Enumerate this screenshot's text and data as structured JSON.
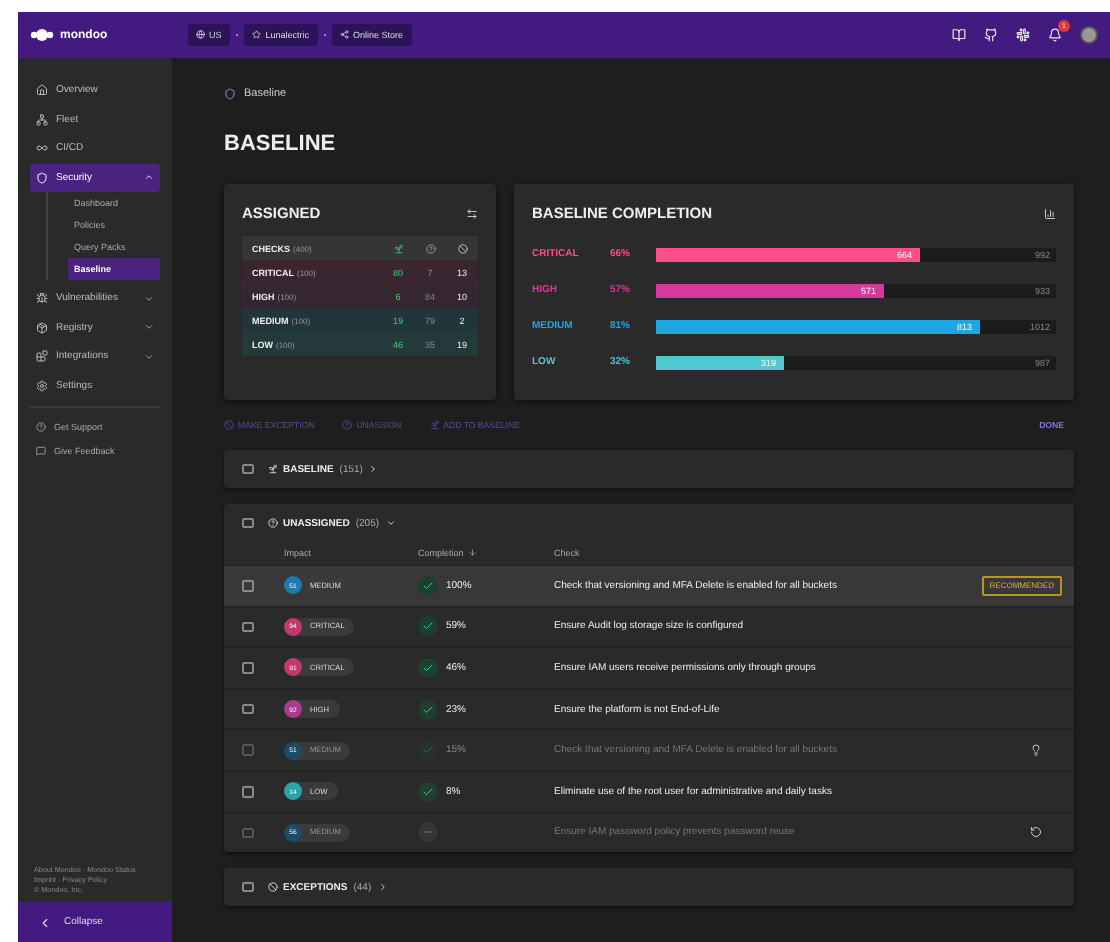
{
  "topbar": {
    "logo": "mondoo",
    "scopes": [
      {
        "label": "US"
      },
      {
        "label": "Lunalectric"
      },
      {
        "label": "Online Store"
      }
    ],
    "notifications": "1"
  },
  "sidebar": {
    "items": [
      {
        "label": "Overview",
        "kind": "link",
        "selected": false
      },
      {
        "label": "Fleet",
        "kind": "link",
        "selected": false
      },
      {
        "label": "CI/CD",
        "kind": "link",
        "selected": false
      },
      {
        "label": "Security",
        "kind": "group",
        "selected": true,
        "expanded": true,
        "children": [
          {
            "label": "Dashboard",
            "selected": false
          },
          {
            "label": "Policies",
            "selected": false
          },
          {
            "label": "Query Packs",
            "selected": false
          },
          {
            "label": "Baseline",
            "selected": true
          }
        ]
      },
      {
        "label": "Vulnerabilities",
        "kind": "group",
        "selected": false,
        "expanded": false
      },
      {
        "label": "Registry",
        "kind": "group",
        "selected": false,
        "expanded": false
      },
      {
        "label": "Integrations",
        "kind": "group",
        "selected": false,
        "expanded": false
      },
      {
        "label": "Settings",
        "kind": "link",
        "selected": false
      }
    ],
    "support": [
      "Get Support",
      "Give Feedback"
    ],
    "footer": [
      "About Mondoo · Mondoo Status ·",
      "Imprint · Privacy Policy",
      "© Mondoo, Inc."
    ],
    "collapse": "Collapse"
  },
  "breadcrumb": "Baseline",
  "title": "BASELINE",
  "assigned": {
    "title": "ASSIGNED",
    "header": {
      "label": "CHECKS",
      "count": "(400)"
    },
    "rows": [
      {
        "label": "CRITICAL",
        "count": "(100)",
        "color": "#3a2630",
        "values": [
          "80",
          "7",
          "13"
        ]
      },
      {
        "label": "HIGH",
        "count": "(100)",
        "color": "#36262f",
        "values": [
          "6",
          "84",
          "10"
        ]
      },
      {
        "label": "MEDIUM",
        "count": "(100)",
        "color": "#22353a",
        "values": [
          "19",
          "79",
          "2"
        ]
      },
      {
        "label": "LOW",
        "count": "(100)",
        "color": "#24393a",
        "values": [
          "46",
          "35",
          "19"
        ]
      }
    ]
  },
  "completion": {
    "title": "BASELINE COMPLETION",
    "rows": [
      {
        "label": "CRITICAL",
        "percent": "66%",
        "level": 0.66,
        "value": "664",
        "total": "992",
        "color": "#ff4f86"
      },
      {
        "label": "HIGH",
        "percent": "57%",
        "level": 0.57,
        "value": "571",
        "total": "933",
        "color": "#d6399a"
      },
      {
        "label": "MEDIUM",
        "percent": "81%",
        "level": 0.81,
        "value": "813",
        "total": "1012",
        "color": "#1ea7e0"
      },
      {
        "label": "LOW",
        "percent": "32%",
        "level": 0.32,
        "value": "319",
        "total": "987",
        "color": "#4fc8d0"
      }
    ]
  },
  "actions": [
    {
      "label": "MAKE EXCEPTION",
      "kind": "exception"
    },
    {
      "label": "UNASSIGN",
      "kind": "unassign"
    },
    {
      "label": "ADD TO BASELINE",
      "kind": "baseline"
    }
  ],
  "done": "DONE",
  "groups": [
    {
      "label": "BASELINE",
      "count": "(151)",
      "kind": "baseline",
      "expanded": false
    },
    {
      "label": "UNASSIGNED",
      "count": "(205)",
      "kind": "unassign",
      "expanded": true,
      "columns": [
        "Impact",
        "Completion",
        "Check"
      ],
      "rows": [
        {
          "score": "51",
          "impact": "MEDIUM",
          "color": "#1e7ab0",
          "kind": "done",
          "percent": "100%",
          "check": "Check that versioning and MFA Delete is enabled for all buckets",
          "dimmed": false,
          "selected": true,
          "badge": "RECOMMENDED"
        },
        {
          "score": "94",
          "impact": "CRITICAL",
          "color": "#c2386f",
          "kind": "done",
          "percent": "59%",
          "check": "Ensure Audit log storage size is configured",
          "dimmed": false,
          "selected": false
        },
        {
          "score": "91",
          "impact": "CRITICAL",
          "color": "#c2386f",
          "kind": "done",
          "percent": "46%",
          "check": "Ensure IAM users receive permissions only through groups",
          "dimmed": false,
          "selected": false
        },
        {
          "score": "92",
          "impact": "HIGH",
          "color": "#a83a8f",
          "kind": "done",
          "percent": "23%",
          "check": "Ensure the platform is not End-of-Life",
          "dimmed": false,
          "selected": false
        },
        {
          "score": "51",
          "impact": "MEDIUM",
          "color": "#1d4a66",
          "kind": "done",
          "percent": "15%",
          "check": "Check that versioning and MFA Delete is enabled for all buckets",
          "dimmed": true,
          "selected": false,
          "action": {
            "kind": "bulb"
          }
        },
        {
          "score": "14",
          "impact": "LOW",
          "color": "#2aa3ab",
          "kind": "done",
          "percent": "8%",
          "check": "Eliminate use of the root user for administrative and daily tasks",
          "dimmed": false,
          "selected": false
        },
        {
          "score": "56",
          "impact": "MEDIUM",
          "color": "#1d4a66",
          "kind": "none",
          "check": "Ensure IAM password policy prevents password reuse",
          "dimmed": true,
          "selected": false,
          "action": {
            "kind": "restore"
          }
        }
      ]
    },
    {
      "label": "EXCEPTIONS",
      "count": "(44)",
      "kind": "exception",
      "expanded": false
    }
  ]
}
